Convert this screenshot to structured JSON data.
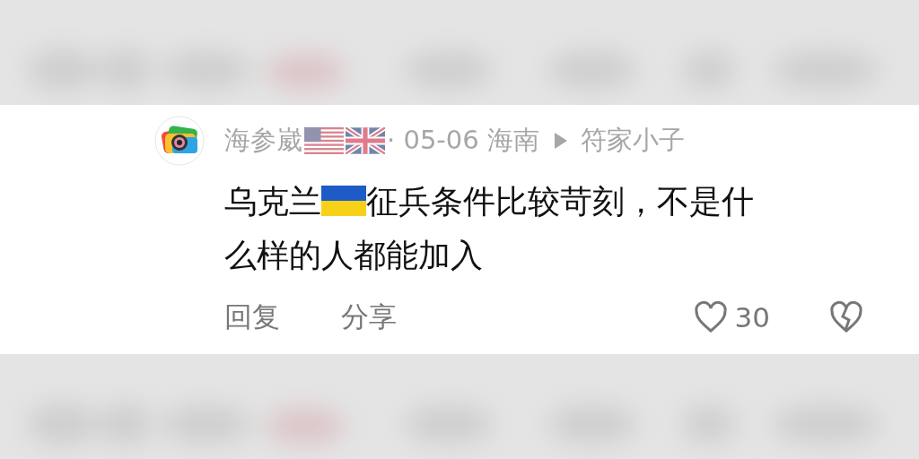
{
  "comment": {
    "author": "海参崴",
    "meta": "· 05-06 海南",
    "reply_to": "符家小子",
    "text_parts": [
      "乌克兰",
      "征兵条件比较苛刻，不是什",
      "么样的人都能加入"
    ],
    "actions": [
      "回复",
      "分享"
    ],
    "like_count": "30"
  }
}
